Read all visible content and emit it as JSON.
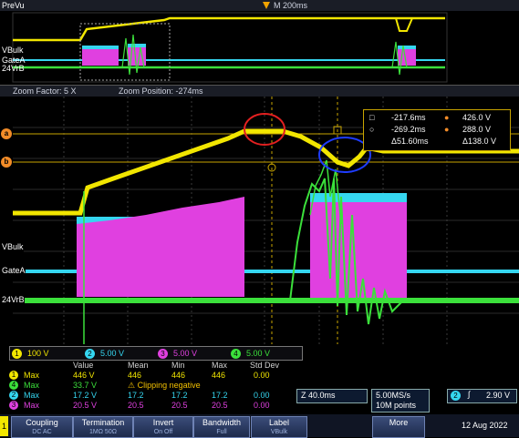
{
  "topbar": {
    "mode_label": "PreVu",
    "timebase": "M 200ms"
  },
  "overview_channels": [
    "VBulk",
    "GateA",
    "24VrB"
  ],
  "zoom": {
    "factor": "Zoom Factor: 5 X",
    "position": "Zoom Position: -274ms"
  },
  "channel_labels": [
    "VBulk",
    "GateA",
    "24VrB"
  ],
  "cursors": {
    "a_marker": "a",
    "b_marker": "b",
    "t1": "-217.6ms",
    "v1": "426.0 V",
    "t2": "-269.2ms",
    "v2": "288.0 V",
    "dt": "Δ51.60ms",
    "dv": "Δ138.0 V"
  },
  "scales": [
    {
      "ch": "1",
      "val": "100 V",
      "color": "#f2e600"
    },
    {
      "ch": "2",
      "val": "5.00 V",
      "color": "#35d6f0"
    },
    {
      "ch": "3",
      "val": "5.00 V",
      "color": "#e040e0"
    },
    {
      "ch": "4",
      "val": "5.00 V",
      "color": "#3be03b"
    }
  ],
  "measurements": {
    "headers": [
      "Value",
      "Mean",
      "Min",
      "Max",
      "Std Dev"
    ],
    "rows": [
      {
        "ch": "1",
        "name": "Max",
        "value": "446 V",
        "mean": "446",
        "min": "446",
        "max": "446",
        "std": "0.00",
        "color": "#f2e600"
      },
      {
        "ch": "4",
        "name": "Max",
        "value": "33.7 V",
        "mean": "⚠ Clipping negative",
        "min": "",
        "max": "",
        "std": "",
        "color": "#3be03b"
      },
      {
        "ch": "2",
        "name": "Max",
        "value": "17.2 V",
        "mean": "17.2",
        "min": "17.2",
        "max": "17.2",
        "std": "0.00",
        "color": "#35d6f0"
      },
      {
        "ch": "3",
        "name": "Max",
        "value": "20.5 V",
        "mean": "20.5",
        "min": "20.5",
        "max": "20.5",
        "std": "0.00",
        "color": "#e040e0"
      }
    ]
  },
  "timebase_info": {
    "zoom_scale": "Z 40.0ms",
    "sample_rate": "5.00MS/s",
    "points": "10M points",
    "trigger_ch": "2",
    "trigger_level": "2.90 V"
  },
  "buttons": [
    {
      "label": "Coupling",
      "sub": "DC  AC"
    },
    {
      "label": "Termination",
      "sub": "1MΩ  50Ω"
    },
    {
      "label": "Invert",
      "sub": "On  Off"
    },
    {
      "label": "Bandwidth",
      "sub": "Full"
    },
    {
      "label": "Label",
      "sub": "VBulk"
    },
    {
      "label": "More",
      "sub": ""
    }
  ],
  "date": "12 Aug 2022",
  "colors": {
    "ch1": "#f2e600",
    "ch2": "#35d6f0",
    "ch3": "#e040e0",
    "ch4": "#3be03b",
    "annot_red": "#e32020",
    "annot_blue": "#1e3cff"
  }
}
